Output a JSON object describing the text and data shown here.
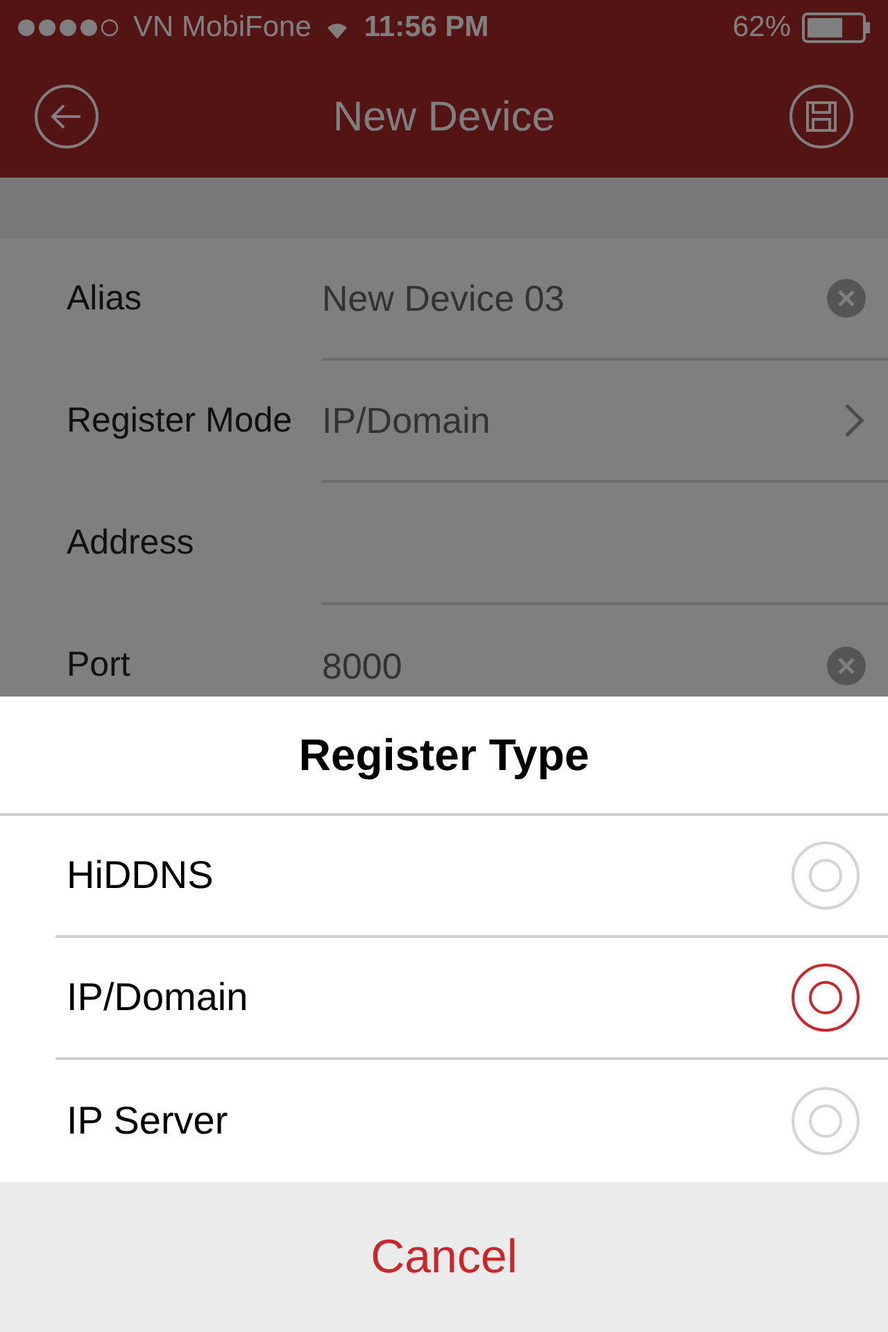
{
  "status_bar": {
    "carrier": "VN MobiFone",
    "time": "11:56 PM",
    "battery": "62%"
  },
  "nav_bar": {
    "title": "New Device"
  },
  "form": [
    {
      "label": "Alias",
      "value": "New Device 03",
      "kind": "clearable"
    },
    {
      "label": "Register Mode",
      "value": "IP/Domain",
      "kind": "chevron"
    },
    {
      "label": "Address",
      "kind": "text"
    },
    {
      "label": "Port",
      "value": "8000",
      "kind": "clearable"
    }
  ],
  "sheet": {
    "title": "Register Type",
    "options": [
      {
        "label": "HiDDNS",
        "selected": false
      },
      {
        "label": "IP/Domain",
        "selected": true
      },
      {
        "label": "IP Server",
        "selected": false
      }
    ],
    "cancel": "Cancel"
  }
}
